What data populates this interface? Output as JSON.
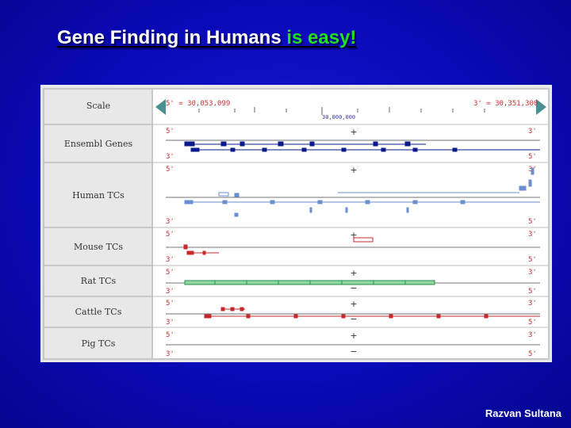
{
  "title": {
    "part1": "Gene Finding in Humans",
    "part2": "is easy!"
  },
  "author": "Razvan Sultana",
  "colors": {
    "ensembl": "#0a1a8c",
    "human": "#6a8fd0",
    "mouse": "#c8282c",
    "rat": "#2e8a4a",
    "cattle": "#c8282c"
  },
  "scale": {
    "label": "Scale",
    "left": "5' = 30,053,099",
    "right": "3' = 30,351,300",
    "mid": "30,000,000"
  },
  "tracks": [
    {
      "id": "ensembl",
      "label": "Ensembl Genes",
      "top5": "5'",
      "top3": "3'",
      "bot3": "3'",
      "bot5": "5'",
      "strand1": "+",
      "strand2": ""
    },
    {
      "id": "human",
      "label": "Human TCs",
      "top5": "5'",
      "top3": "3'",
      "bot3": "3'",
      "bot5": "5'",
      "strand1": "+",
      "strand2": ""
    },
    {
      "id": "mouse",
      "label": "Mouse TCs",
      "top5": "5'",
      "top3": "3'",
      "bot3": "3'",
      "bot5": "5'",
      "strand1": "+",
      "strand2": ""
    },
    {
      "id": "rat",
      "label": "Rat TCs",
      "top5": "5'",
      "top3": "3'",
      "bot3": "3'",
      "bot5": "5'",
      "strand1": "+",
      "strand2": "−"
    },
    {
      "id": "cattle",
      "label": "Cattle TCs",
      "top5": "5'",
      "top3": "3'",
      "bot3": "3'",
      "bot5": "5'",
      "strand1": "+",
      "strand2": "−"
    },
    {
      "id": "pig",
      "label": "Pig TCs",
      "top5": "5'",
      "top3": "3'",
      "bot3": "3'",
      "bot5": "5'",
      "strand1": "+",
      "strand2": "−"
    }
  ]
}
